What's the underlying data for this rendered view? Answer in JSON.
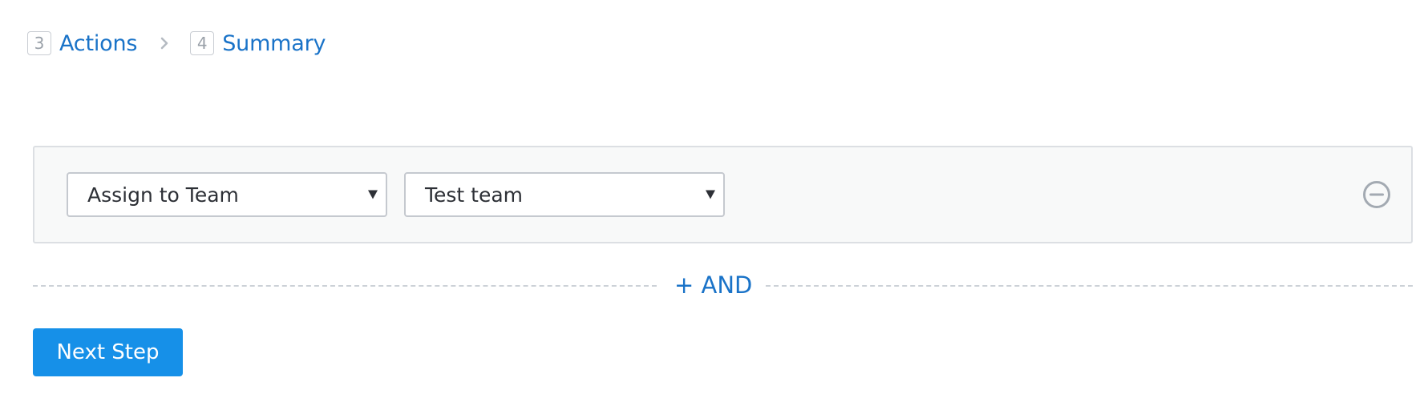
{
  "breadcrumb": {
    "steps": [
      {
        "number": "3",
        "label": "Actions"
      },
      {
        "number": "4",
        "label": "Summary"
      }
    ]
  },
  "action_rule": {
    "action_select": {
      "value": "Assign to Team"
    },
    "team_select": {
      "value": "Test team"
    },
    "remove_icon": "minus-circle-icon"
  },
  "and_button": {
    "label": "+ AND"
  },
  "next_step_button": {
    "label": "Next Step"
  },
  "colors": {
    "link": "#1a73c8",
    "primary_button": "#1690e8",
    "muted": "#9aa1a9"
  }
}
